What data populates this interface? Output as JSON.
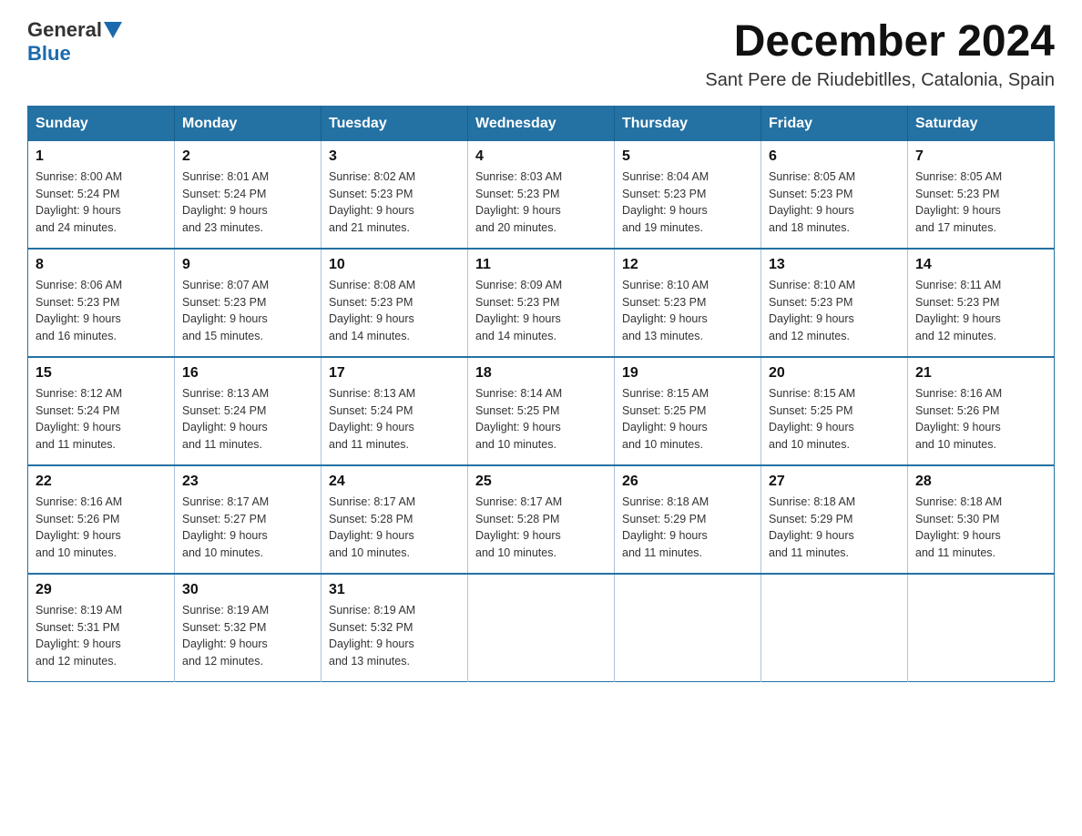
{
  "header": {
    "logo_general": "General",
    "logo_blue": "Blue",
    "month_title": "December 2024",
    "location": "Sant Pere de Riudebitlles, Catalonia, Spain"
  },
  "weekdays": [
    "Sunday",
    "Monday",
    "Tuesday",
    "Wednesday",
    "Thursday",
    "Friday",
    "Saturday"
  ],
  "weeks": [
    [
      {
        "day": "1",
        "sunrise": "8:00 AM",
        "sunset": "5:24 PM",
        "daylight": "9 hours and 24 minutes."
      },
      {
        "day": "2",
        "sunrise": "8:01 AM",
        "sunset": "5:24 PM",
        "daylight": "9 hours and 23 minutes."
      },
      {
        "day": "3",
        "sunrise": "8:02 AM",
        "sunset": "5:23 PM",
        "daylight": "9 hours and 21 minutes."
      },
      {
        "day": "4",
        "sunrise": "8:03 AM",
        "sunset": "5:23 PM",
        "daylight": "9 hours and 20 minutes."
      },
      {
        "day": "5",
        "sunrise": "8:04 AM",
        "sunset": "5:23 PM",
        "daylight": "9 hours and 19 minutes."
      },
      {
        "day": "6",
        "sunrise": "8:05 AM",
        "sunset": "5:23 PM",
        "daylight": "9 hours and 18 minutes."
      },
      {
        "day": "7",
        "sunrise": "8:05 AM",
        "sunset": "5:23 PM",
        "daylight": "9 hours and 17 minutes."
      }
    ],
    [
      {
        "day": "8",
        "sunrise": "8:06 AM",
        "sunset": "5:23 PM",
        "daylight": "9 hours and 16 minutes."
      },
      {
        "day": "9",
        "sunrise": "8:07 AM",
        "sunset": "5:23 PM",
        "daylight": "9 hours and 15 minutes."
      },
      {
        "day": "10",
        "sunrise": "8:08 AM",
        "sunset": "5:23 PM",
        "daylight": "9 hours and 14 minutes."
      },
      {
        "day": "11",
        "sunrise": "8:09 AM",
        "sunset": "5:23 PM",
        "daylight": "9 hours and 14 minutes."
      },
      {
        "day": "12",
        "sunrise": "8:10 AM",
        "sunset": "5:23 PM",
        "daylight": "9 hours and 13 minutes."
      },
      {
        "day": "13",
        "sunrise": "8:10 AM",
        "sunset": "5:23 PM",
        "daylight": "9 hours and 12 minutes."
      },
      {
        "day": "14",
        "sunrise": "8:11 AM",
        "sunset": "5:23 PM",
        "daylight": "9 hours and 12 minutes."
      }
    ],
    [
      {
        "day": "15",
        "sunrise": "8:12 AM",
        "sunset": "5:24 PM",
        "daylight": "9 hours and 11 minutes."
      },
      {
        "day": "16",
        "sunrise": "8:13 AM",
        "sunset": "5:24 PM",
        "daylight": "9 hours and 11 minutes."
      },
      {
        "day": "17",
        "sunrise": "8:13 AM",
        "sunset": "5:24 PM",
        "daylight": "9 hours and 11 minutes."
      },
      {
        "day": "18",
        "sunrise": "8:14 AM",
        "sunset": "5:25 PM",
        "daylight": "9 hours and 10 minutes."
      },
      {
        "day": "19",
        "sunrise": "8:15 AM",
        "sunset": "5:25 PM",
        "daylight": "9 hours and 10 minutes."
      },
      {
        "day": "20",
        "sunrise": "8:15 AM",
        "sunset": "5:25 PM",
        "daylight": "9 hours and 10 minutes."
      },
      {
        "day": "21",
        "sunrise": "8:16 AM",
        "sunset": "5:26 PM",
        "daylight": "9 hours and 10 minutes."
      }
    ],
    [
      {
        "day": "22",
        "sunrise": "8:16 AM",
        "sunset": "5:26 PM",
        "daylight": "9 hours and 10 minutes."
      },
      {
        "day": "23",
        "sunrise": "8:17 AM",
        "sunset": "5:27 PM",
        "daylight": "9 hours and 10 minutes."
      },
      {
        "day": "24",
        "sunrise": "8:17 AM",
        "sunset": "5:28 PM",
        "daylight": "9 hours and 10 minutes."
      },
      {
        "day": "25",
        "sunrise": "8:17 AM",
        "sunset": "5:28 PM",
        "daylight": "9 hours and 10 minutes."
      },
      {
        "day": "26",
        "sunrise": "8:18 AM",
        "sunset": "5:29 PM",
        "daylight": "9 hours and 11 minutes."
      },
      {
        "day": "27",
        "sunrise": "8:18 AM",
        "sunset": "5:29 PM",
        "daylight": "9 hours and 11 minutes."
      },
      {
        "day": "28",
        "sunrise": "8:18 AM",
        "sunset": "5:30 PM",
        "daylight": "9 hours and 11 minutes."
      }
    ],
    [
      {
        "day": "29",
        "sunrise": "8:19 AM",
        "sunset": "5:31 PM",
        "daylight": "9 hours and 12 minutes."
      },
      {
        "day": "30",
        "sunrise": "8:19 AM",
        "sunset": "5:32 PM",
        "daylight": "9 hours and 12 minutes."
      },
      {
        "day": "31",
        "sunrise": "8:19 AM",
        "sunset": "5:32 PM",
        "daylight": "9 hours and 13 minutes."
      },
      null,
      null,
      null,
      null
    ]
  ]
}
